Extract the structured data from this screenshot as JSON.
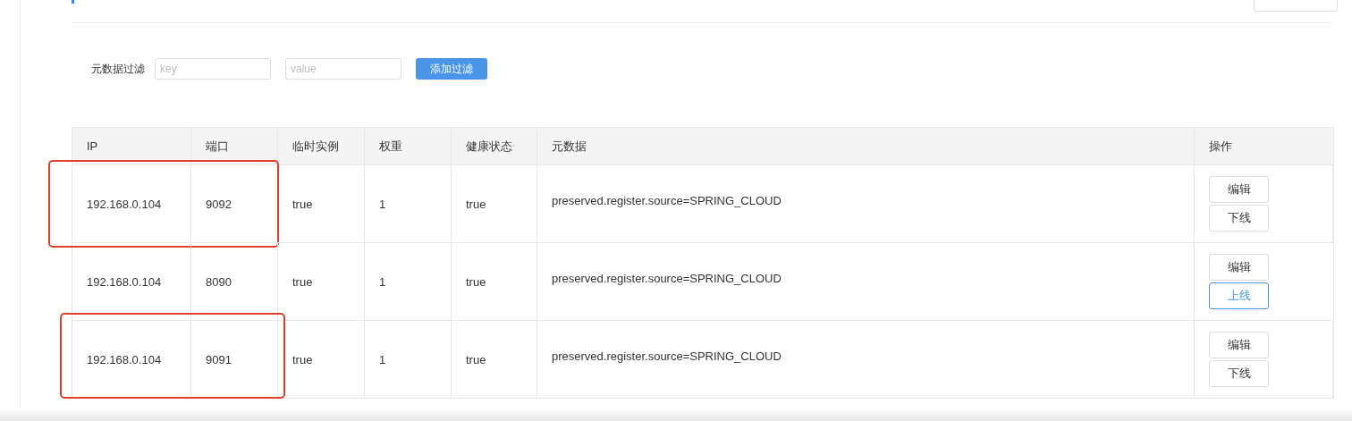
{
  "filter": {
    "label": "元数据过滤",
    "key_placeholder": "key",
    "value_placeholder": "value",
    "button": "添加过滤"
  },
  "table": {
    "columns": [
      "IP",
      "端口",
      "临时实例",
      "权重",
      "健康状态",
      "元数据",
      "操作"
    ],
    "rows": [
      {
        "ip": "192.168.0.104",
        "port": "9092",
        "ephemeral": "true",
        "weight": "1",
        "healthy": "true",
        "metadata": "preserved.register.source=SPRING_CLOUD",
        "highlighted": true,
        "actions": [
          {
            "label": "编辑",
            "kind": "default"
          },
          {
            "label": "下线",
            "kind": "default"
          }
        ]
      },
      {
        "ip": "192.168.0.104",
        "port": "8090",
        "ephemeral": "true",
        "weight": "1",
        "healthy": "true",
        "metadata": "preserved.register.source=SPRING_CLOUD",
        "highlighted": false,
        "actions": [
          {
            "label": "编辑",
            "kind": "default"
          },
          {
            "label": "上线",
            "kind": "primary"
          }
        ]
      },
      {
        "ip": "192.168.0.104",
        "port": "9091",
        "ephemeral": "true",
        "weight": "1",
        "healthy": "true",
        "metadata": "preserved.register.source=SPRING_CLOUD",
        "highlighted": true,
        "actions": [
          {
            "label": "编辑",
            "kind": "default"
          },
          {
            "label": "下线",
            "kind": "default"
          }
        ]
      }
    ]
  }
}
